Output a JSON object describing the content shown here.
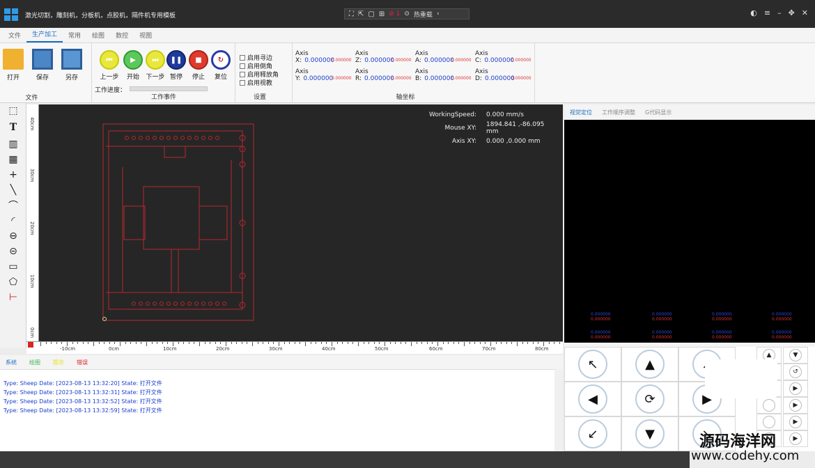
{
  "app": {
    "title": "激光切割，雕刻机，分板机，点胶机，隔件机专用模板",
    "qat_badge": "⊘ 1",
    "qat_label": "热重载"
  },
  "menu": {
    "tabs": [
      "文件",
      "生产加工",
      "常用",
      "绘图",
      "数控",
      "视图"
    ],
    "active": "生产加工"
  },
  "ribbon": {
    "file_group": {
      "label": "文件",
      "open": "打开",
      "save": "保存",
      "save_as": "另存"
    },
    "work_group": {
      "label": "工作事件",
      "prev": "上一步",
      "start": "开始",
      "next": "下一步",
      "pause": "暂停",
      "stop": "停止",
      "reset": "复位",
      "progress_label": "工作进度：",
      "progress": 0
    },
    "settings_group": {
      "label": "设置",
      "options": [
        "启用寻边",
        "启用倒角",
        "启用释放角",
        "启用视教"
      ]
    },
    "axis_group": {
      "label": "轴坐标",
      "axes": [
        {
          "name": "Axis X:",
          "value": "0.000000",
          "sub": "0.000000"
        },
        {
          "name": "Axis Z:",
          "value": "0.000000",
          "sub": "0.000000"
        },
        {
          "name": "Axis A:",
          "value": "0.000000",
          "sub": "0.000000"
        },
        {
          "name": "Axis C:",
          "value": "0.000000",
          "sub": "0.000000"
        },
        {
          "name": "Axis Y:",
          "value": "0.000000",
          "sub": "0.000000"
        },
        {
          "name": "Axis R:",
          "value": "0.000000",
          "sub": "0.000000"
        },
        {
          "name": "Axis B:",
          "value": "0.000000",
          "sub": "0.000000"
        },
        {
          "name": "Axis D:",
          "value": "0.000000",
          "sub": "0.000000"
        }
      ]
    }
  },
  "canvas": {
    "working_speed_label": "WorkingSpeed:",
    "working_speed": "0.000 mm/s",
    "mouse_label": "Mouse XY:",
    "mouse_xy": "1894.841 ,-86.095 mm",
    "axis_label": "Axis XY:",
    "axis_xy": "0.000 ,0.000 mm"
  },
  "rulers": {
    "horizontal": [
      "-10cm",
      "0cm",
      "10cm",
      "20cm",
      "30cm",
      "40cm",
      "50cm",
      "60cm",
      "70cm",
      "80cm"
    ],
    "vertical": [
      "40cm",
      "30cm",
      "20cm",
      "10cm",
      "0cm"
    ]
  },
  "log": {
    "tabs": [
      "系统",
      "绘图",
      "提示",
      "错误"
    ],
    "lines": [
      "Type: Sheep  Date: [2023-08-13 13:32:20]  State: 打开文件",
      "Type: Sheep  Date: [2023-08-13 13:32:31]  State: 打开文件",
      "Type: Sheep  Date: [2023-08-13 13:32:52]  State: 打开文件",
      "Type: Sheep  Date: [2023-08-13 13:32:59]  State: 打开文件"
    ]
  },
  "right_panel": {
    "tabs": [
      "视觉定位",
      "工作顺序调整",
      "G代码显示"
    ],
    "mini_values": [
      {
        "a": "0.000000",
        "b": "0.000000"
      },
      {
        "a": "0.000000",
        "b": "0.000000"
      },
      {
        "a": "0.000000",
        "b": "0.000000"
      },
      {
        "a": "0.000000",
        "b": "0.000000"
      },
      {
        "a": "0.000000",
        "b": "0.000000"
      },
      {
        "a": "0.000000",
        "b": "0.000000"
      },
      {
        "a": "0.000000",
        "b": "0.000000"
      },
      {
        "a": "0.000000",
        "b": "0.000000"
      }
    ]
  },
  "watermark": {
    "line1": "源码海洋网",
    "line2": "www.codehy.com"
  },
  "colors": {
    "accent": "#1b6ec2",
    "canvas_bg": "#262626",
    "drawing": "#b8282e"
  }
}
